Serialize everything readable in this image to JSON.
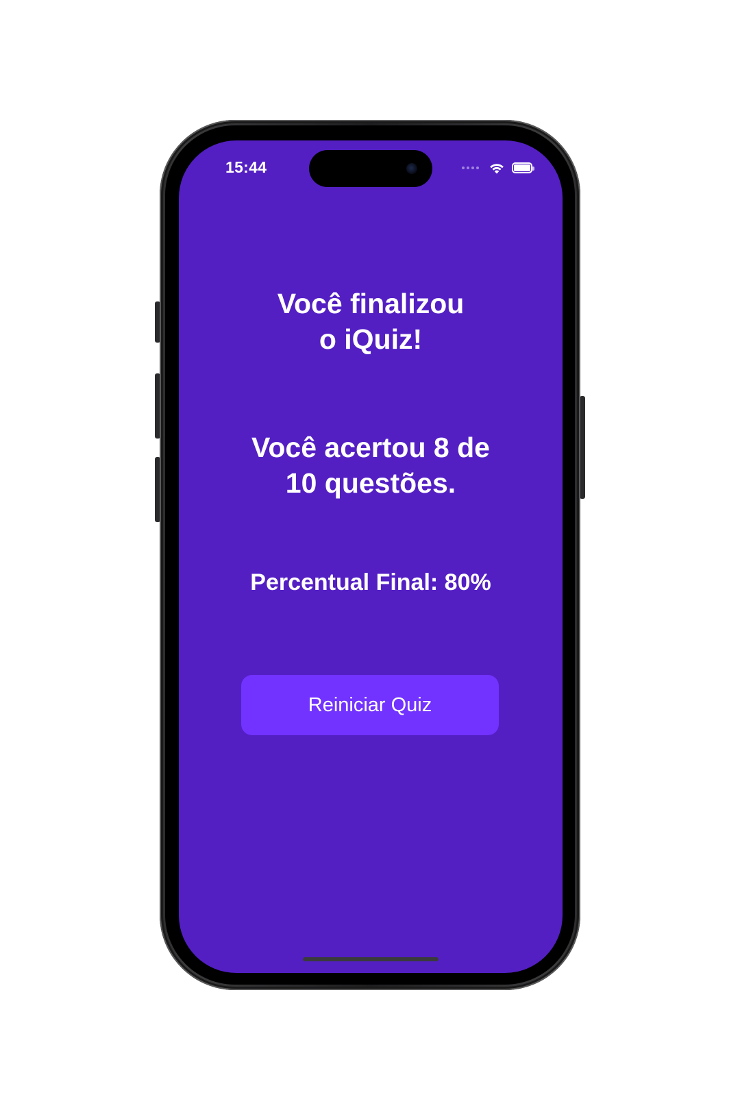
{
  "status_bar": {
    "time": "15:44",
    "icons": [
      "cellular-signal-icon",
      "wifi-icon",
      "battery-icon"
    ]
  },
  "quiz_result": {
    "title_line1": "Você finalizou",
    "title_line2": "o iQuiz!",
    "score_line1": "Você acertou 8 de",
    "score_line2": "10 questões.",
    "percent_text": "Percentual Final: 80%",
    "correct": 8,
    "total": 10,
    "percent": 80
  },
  "actions": {
    "restart_label": "Reiniciar Quiz"
  },
  "colors": {
    "background": "#531fc3",
    "button": "#7232ff",
    "text": "#ffffff"
  }
}
